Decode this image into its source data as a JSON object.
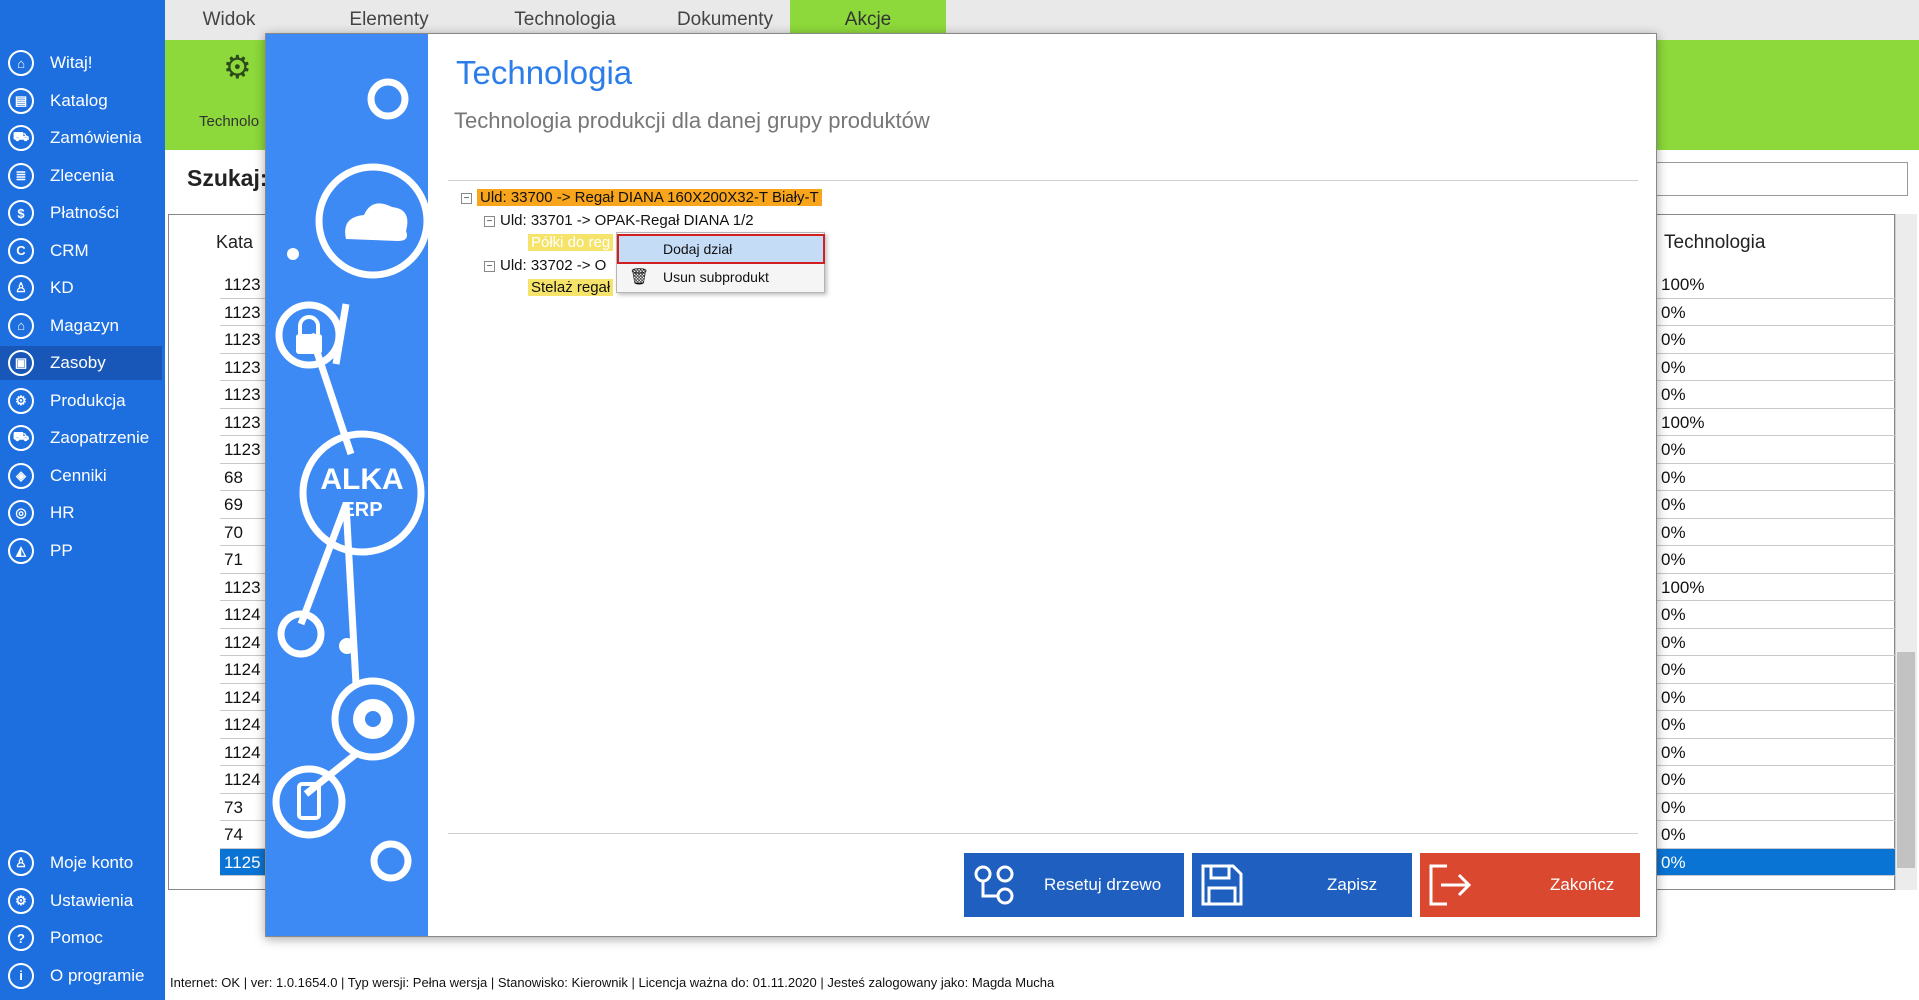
{
  "sidebar": {
    "items": [
      {
        "label": "Witaj!",
        "icon": "home-icon",
        "glyph": "⌂"
      },
      {
        "label": "Katalog",
        "icon": "book-icon",
        "glyph": "▤"
      },
      {
        "label": "Zamówienia",
        "icon": "cart-icon",
        "glyph": "⛟"
      },
      {
        "label": "Zlecenia",
        "icon": "list-icon",
        "glyph": "≣"
      },
      {
        "label": "Płatności",
        "icon": "dollar-icon",
        "glyph": "$"
      },
      {
        "label": "CRM",
        "icon": "crm-icon",
        "glyph": "C"
      },
      {
        "label": "KD",
        "icon": "user-icon",
        "glyph": "♙"
      },
      {
        "label": "Magazyn",
        "icon": "warehouse-icon",
        "glyph": "⌂"
      },
      {
        "label": "Zasoby",
        "icon": "box-icon",
        "glyph": "▣"
      },
      {
        "label": "Produkcja",
        "icon": "factory-icon",
        "glyph": "⚙"
      },
      {
        "label": "Zaopatrzenie",
        "icon": "truck-icon",
        "glyph": "⛟"
      },
      {
        "label": "Cenniki",
        "icon": "tag-icon",
        "glyph": "◈"
      },
      {
        "label": "HR",
        "icon": "hr-icon",
        "glyph": "◎"
      },
      {
        "label": "PP",
        "icon": "chart-icon",
        "glyph": "◭"
      }
    ],
    "bottom_items": [
      {
        "label": "Moje konto",
        "icon": "account-icon",
        "glyph": "♙"
      },
      {
        "label": "Ustawienia",
        "icon": "settings-icon",
        "glyph": "⚙"
      },
      {
        "label": "Pomoc",
        "icon": "help-icon",
        "glyph": "?"
      },
      {
        "label": "O programie",
        "icon": "info-icon",
        "glyph": "i"
      }
    ],
    "active_index": 8
  },
  "topbar": {
    "tabs": [
      "Widok",
      "Elementy",
      "Technologia",
      "Dokumenty",
      "Akcje"
    ],
    "active_tab": "Akcje"
  },
  "ribbon": {
    "label": "Technolo"
  },
  "background": {
    "search_label": "Szukaj:",
    "column_kat": "Kata",
    "column_tech": "Technologia",
    "rows": [
      {
        "kat": "1123",
        "tech": "100%"
      },
      {
        "kat": "1123",
        "tech": "0%"
      },
      {
        "kat": "1123",
        "tech": "0%"
      },
      {
        "kat": "1123",
        "tech": "0%"
      },
      {
        "kat": "1123",
        "tech": "0%"
      },
      {
        "kat": "1123",
        "tech": "100%"
      },
      {
        "kat": "1123",
        "tech": "0%"
      },
      {
        "kat": "68",
        "tech": "0%"
      },
      {
        "kat": "69",
        "tech": "0%"
      },
      {
        "kat": "70",
        "tech": "0%"
      },
      {
        "kat": "71",
        "tech": "0%"
      },
      {
        "kat": "1123",
        "tech": "100%"
      },
      {
        "kat": "1124",
        "tech": "0%"
      },
      {
        "kat": "1124",
        "tech": "0%"
      },
      {
        "kat": "1124",
        "tech": "0%"
      },
      {
        "kat": "1124",
        "tech": "0%"
      },
      {
        "kat": "1124",
        "tech": "0%"
      },
      {
        "kat": "1124",
        "tech": "0%"
      },
      {
        "kat": "1124",
        "tech": "0%"
      },
      {
        "kat": "73",
        "tech": "0%"
      },
      {
        "kat": "74",
        "tech": "0%"
      },
      {
        "kat": "1125",
        "tech": "0%"
      }
    ],
    "selected_row": 21
  },
  "modal": {
    "title": "Technologia",
    "subtitle": "Technologia produkcji dla danej grupy produktów",
    "logo_line1": "ALKA",
    "logo_line2": "ERP",
    "tree": {
      "root": "Uld: 33700 -> Regał DIANA 160X200X32-T Biały-T",
      "child1": "Uld: 33701 -> OPAK-Regał DIANA   1/2",
      "child1_leaf": "Półki do reg",
      "child2": "Uld: 33702 -> O",
      "child2_leaf": "Stelaż regał"
    },
    "context_menu": {
      "add": "Dodaj dział",
      "remove": "Usun subprodukt"
    },
    "buttons": {
      "reset": "Resetuj drzewo",
      "save": "Zapisz",
      "close": "Zakończ"
    }
  },
  "statusbar": "Internet: OK  |   ver: 1.0.1654.0   |   Typ wersji: Pełna wersja   |   Stanowisko: Kierownik   |   Licencja ważna do: 01.11.2020   |   Jesteś zalogowany jako: Magda Mucha",
  "colors": {
    "sidebar_blue": "#1d6fe0",
    "ribbon_green": "#8dd93b",
    "modal_side_blue": "#3d8af5",
    "save_blue": "#1f5fbf",
    "close_red": "#d9482f",
    "tree_root_highlight": "#f9a51c",
    "tree_leaf_highlight": "#f6e36a"
  }
}
